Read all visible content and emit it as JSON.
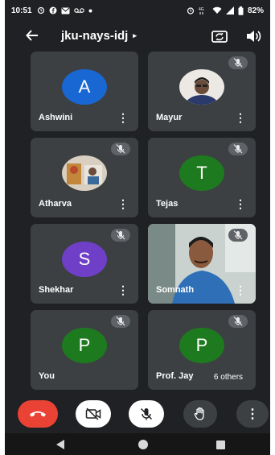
{
  "status_bar": {
    "time": "10:51",
    "left_icons": [
      "alarm-icon",
      "facebook-icon",
      "gmail-icon",
      "voicemail-icon",
      "dot-icon"
    ],
    "right_icons": [
      "alarm-icon",
      "data-icon",
      "wifi-icon",
      "signal-icon",
      "battery-icon"
    ],
    "battery": "82%"
  },
  "topbar": {
    "back_icon": "arrow-left-icon",
    "meeting_code": "jku-nays-idj",
    "chevron": "▸",
    "camera_switch_icon": "camera-switch-icon",
    "speaker_icon": "speaker-icon"
  },
  "participants": [
    {
      "name": "Ashwini",
      "initial": "A",
      "avatar_color": "#1967d2",
      "muted": false
    },
    {
      "name": "Mayur",
      "initial": "",
      "avatar_color": "#f1f1f1",
      "muted": true,
      "photo": true
    },
    {
      "name": "Atharva",
      "initial": "",
      "avatar_color": "#e8e2d8",
      "muted": true,
      "photo": true
    },
    {
      "name": "Tejas",
      "initial": "T",
      "avatar_color": "#1e7a1e",
      "muted": true
    },
    {
      "name": "Shekhar",
      "initial": "S",
      "avatar_color": "#6f3fc8",
      "muted": true
    },
    {
      "name": "Somnath",
      "initial": "",
      "muted": true,
      "video": true
    },
    {
      "name": "You",
      "initial": "P",
      "avatar_color": "#1e7a1e",
      "muted": true
    },
    {
      "name": "Prof. Jay",
      "initial": "P",
      "avatar_color": "#1e7a1e",
      "muted": true
    }
  ],
  "others_chip": "6 others",
  "controls": {
    "hangup_icon": "hang-up-icon",
    "camera_icon": "camera-off-icon",
    "mic_icon": "mic-off-icon",
    "hand_icon": "raise-hand-icon",
    "more_icon": "more-vertical-icon",
    "more_glyph": "⋮"
  },
  "kebab_glyph": "⋮",
  "colors": {
    "background": "#202124",
    "tile": "#3c4043",
    "hangup": "#ea4335"
  }
}
